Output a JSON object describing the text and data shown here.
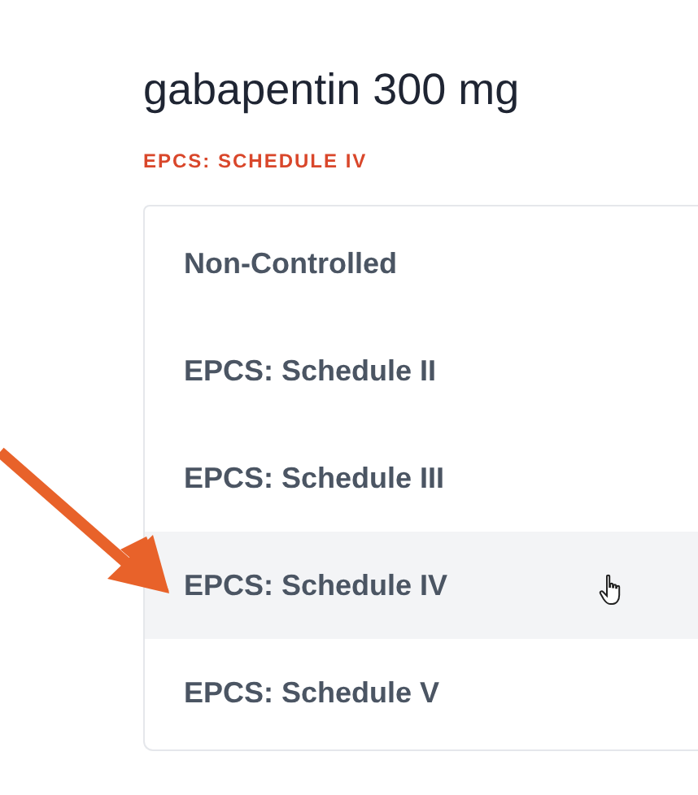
{
  "title": "gabapentin 300 mg",
  "schedule_label": "EPCS: SCHEDULE IV",
  "menu": {
    "items": [
      {
        "label": "Non-Controlled",
        "hovered": false
      },
      {
        "label": "EPCS: Schedule II",
        "hovered": false
      },
      {
        "label": "EPCS: Schedule III",
        "hovered": false
      },
      {
        "label": "EPCS: Schedule IV",
        "hovered": true
      },
      {
        "label": "EPCS: Schedule V",
        "hovered": false
      }
    ]
  }
}
